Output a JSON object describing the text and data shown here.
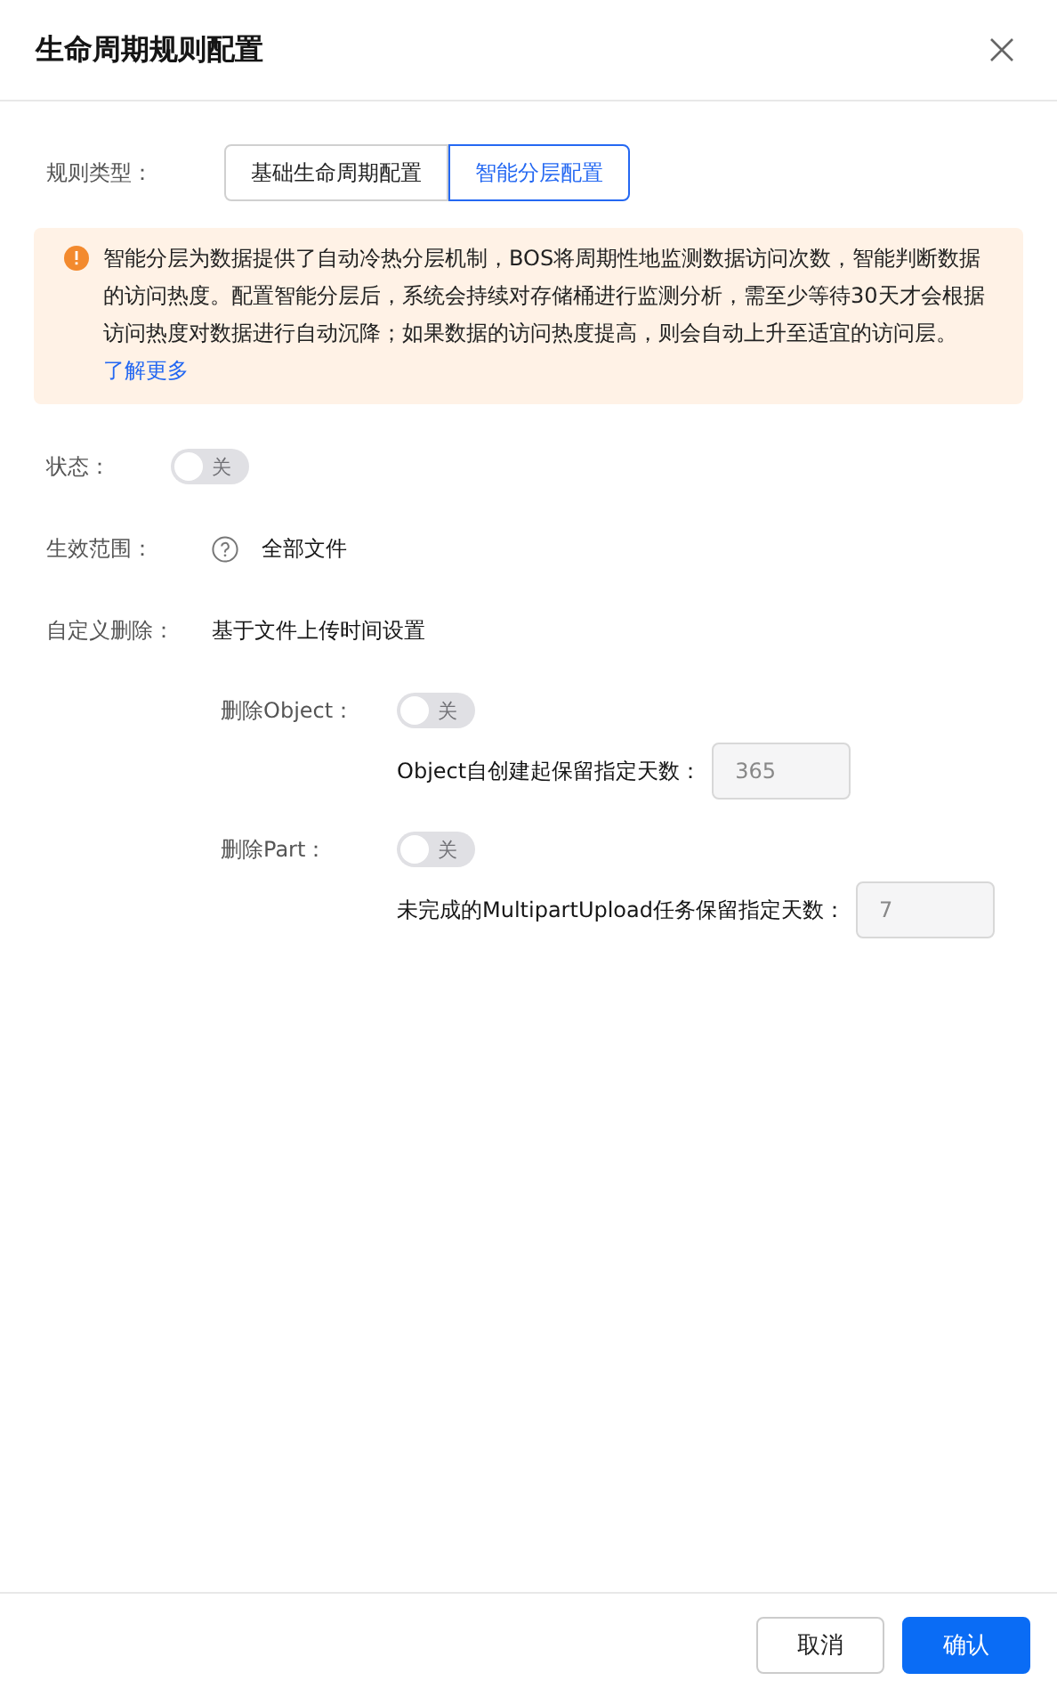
{
  "dialog": {
    "title": "生命周期规则配置"
  },
  "rule_type": {
    "label": "规则类型：",
    "options": [
      {
        "label": "基础生命周期配置",
        "selected": false
      },
      {
        "label": "智能分层配置",
        "selected": true
      }
    ]
  },
  "notice": {
    "text": "智能分层为数据提供了自动冷热分层机制，BOS将周期性地监测数据访问次数，智能判断数据的访问热度。配置智能分层后，系统会持续对存储桶进行监测分析，需至少等待30天才会根据访问热度对数据进行自动沉降；如果数据的访问热度提高，则会自动上升至适宜的访问层。",
    "link": "了解更多"
  },
  "fields": [
    {
      "kind": "toggle",
      "label": "状态：",
      "on": false,
      "toggle_text": "关"
    },
    {
      "kind": "text",
      "label": "生效范围：",
      "help": true,
      "value": "全部文件"
    },
    {
      "kind": "text",
      "label": "自定义删除：",
      "help": false,
      "value": "基于文件上传时间设置"
    }
  ],
  "delete_rules": [
    {
      "label": "删除Object：",
      "on": false,
      "toggle_text": "关",
      "days_label": "Object自创建起保留指定天数：",
      "days_value": "365",
      "disabled": true
    },
    {
      "label": "删除Part：",
      "on": false,
      "toggle_text": "关",
      "days_label": "未完成的MultipartUpload任务保留指定天数：",
      "days_value": "7",
      "disabled": true
    }
  ],
  "buttons": [
    {
      "label": "取消",
      "kind": "secondary"
    },
    {
      "label": "确认",
      "kind": "primary"
    }
  ]
}
